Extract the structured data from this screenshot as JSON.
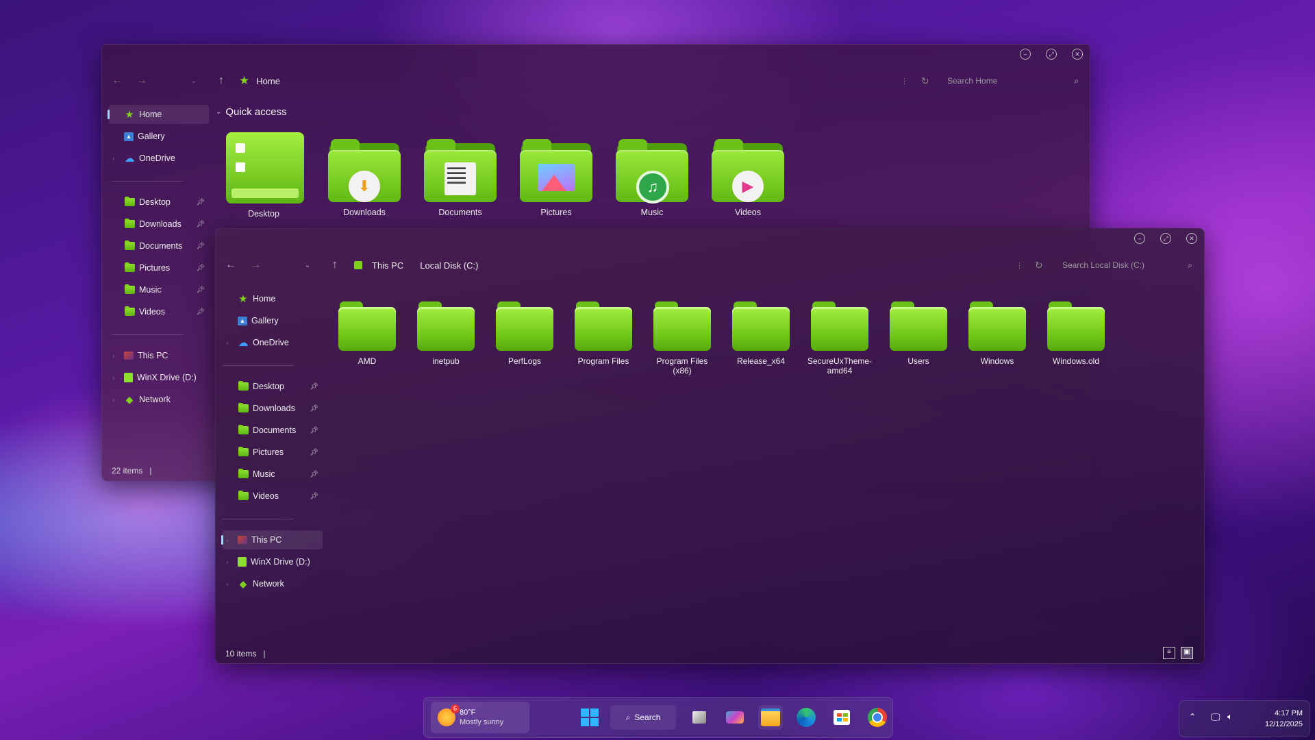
{
  "window_home": {
    "breadcrumb": "Home",
    "search_placeholder": "Search Home",
    "status": "22 items",
    "section": "Quick access",
    "sidebar": {
      "home": "Home",
      "gallery": "Gallery",
      "onedrive": "OneDrive",
      "pinned": [
        "Desktop",
        "Downloads",
        "Documents",
        "Pictures",
        "Music",
        "Videos"
      ],
      "thispc": "This PC",
      "winx": "WinX Drive (D:)",
      "network": "Network"
    },
    "quick_access": [
      "Desktop",
      "Downloads",
      "Documents",
      "Pictures",
      "Music",
      "Videos"
    ]
  },
  "window_c": {
    "crumb1": "This PC",
    "crumb2": "Local Disk (C:)",
    "search_placeholder": "Search Local Disk (C:)",
    "status": "10 items",
    "sidebar": {
      "home": "Home",
      "gallery": "Gallery",
      "onedrive": "OneDrive",
      "pinned": [
        "Desktop",
        "Downloads",
        "Documents",
        "Pictures",
        "Music",
        "Videos"
      ],
      "thispc": "This PC",
      "winx": "WinX Drive (D:)",
      "network": "Network"
    },
    "folders": [
      "AMD",
      "inetpub",
      "PerfLogs",
      "Program Files",
      "Program Files (x86)",
      "Release_x64",
      "SecureUxTheme-amd64",
      "Users",
      "Windows",
      "Windows.old"
    ]
  },
  "taskbar": {
    "weather_temp": "80°F",
    "weather_desc": "Mostly sunny",
    "weather_badge": "6",
    "search_label": "Search"
  },
  "tray": {
    "time": "4:17 PM",
    "date": "12/12/2025"
  },
  "colors": {
    "folder_green": "#8fe02e",
    "accent": "#9fd6ff"
  }
}
